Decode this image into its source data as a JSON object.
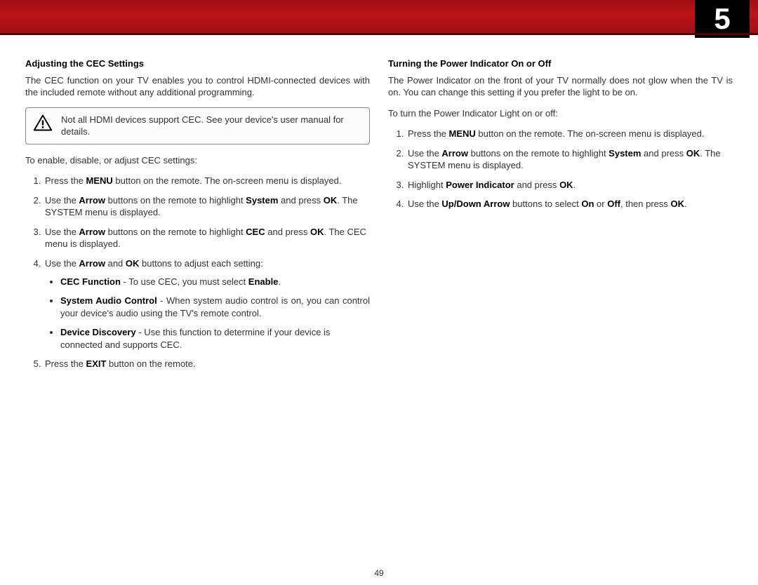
{
  "chapter_number": "5",
  "page_number": "49",
  "left": {
    "heading": "Adjusting the CEC Settings",
    "intro": "The CEC function on your TV enables you to control HDMI-connected devices with the included remote without any additional programming.",
    "warning": "Not all HDMI devices support CEC. See your device's user manual for details.",
    "lead": "To enable, disable, or adjust CEC settings:",
    "s1a": "Press the ",
    "s1b": "MENU",
    "s1c": " button on the remote. The on-screen menu is displayed.",
    "s2a": "Use the ",
    "s2b": "Arrow",
    "s2c": " buttons on the remote to highlight ",
    "s2d": "System",
    "s2e": " and press ",
    "s2f": "OK",
    "s2g": ". The SYSTEM menu is displayed.",
    "s3a": "Use the ",
    "s3b": "Arrow",
    "s3c": " buttons on the remote to highlight ",
    "s3d": "CEC",
    "s3e": " and press ",
    "s3f": "OK",
    "s3g": ". The CEC menu is displayed.",
    "s4a": "Use the ",
    "s4b": "Arrow",
    "s4c": " and ",
    "s4d": "OK",
    "s4e": " buttons to adjust each setting:",
    "b1a": "CEC Function",
    "b1b": " - To use CEC, you must select ",
    "b1c": "Enable",
    "b1d": ".",
    "b2a": "System Audio Control",
    "b2b": " - When system audio control is on, you can control your device's audio using the TV's remote control.",
    "b3a": "Device Discovery",
    "b3b": " - Use this function to determine if your device is connected and supports CEC.",
    "s5a": "Press the ",
    "s5b": "EXIT",
    "s5c": " button on the remote."
  },
  "right": {
    "heading": "Turning the Power Indicator On or Off",
    "intro": "The Power Indicator on the front of your TV normally does not glow when the TV is on. You can change this setting if you prefer the light to be on.",
    "lead": "To turn the Power Indicator Light on or off:",
    "s1a": "Press the ",
    "s1b": "MENU",
    "s1c": " button on the remote. The on-screen menu is displayed.",
    "s2a": "Use the ",
    "s2b": "Arrow",
    "s2c": " buttons on the remote to highlight ",
    "s2d": "System",
    "s2e": " and press ",
    "s2f": "OK",
    "s2g": ". The SYSTEM menu is displayed.",
    "s3a": "Highlight ",
    "s3b": "Power Indicator",
    "s3c": " and press ",
    "s3d": "OK",
    "s3e": ".",
    "s4a": "Use the ",
    "s4b": "Up/Down Arrow",
    "s4c": " buttons to select ",
    "s4d": "On",
    "s4e": " or ",
    "s4f": "Off",
    "s4g": ", then press ",
    "s4h": "OK",
    "s4i": "."
  }
}
